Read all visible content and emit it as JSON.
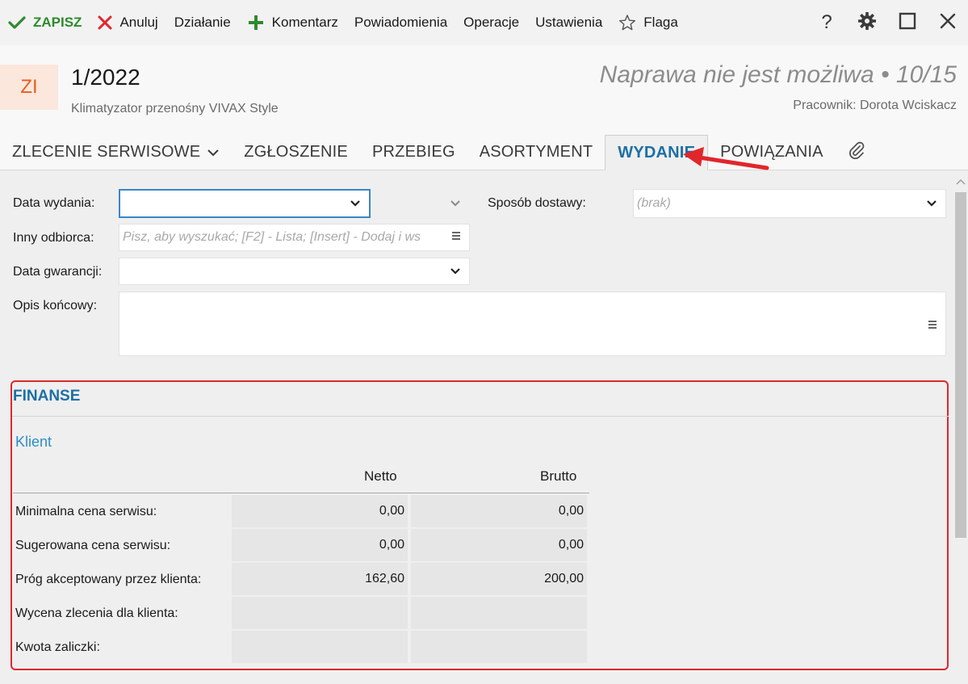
{
  "toolbar": {
    "save_label": "ZAPISZ",
    "cancel_label": "Anuluj",
    "action_label": "Działanie",
    "comment_label": "Komentarz",
    "notifications_label": "Powiadomienia",
    "operations_label": "Operacje",
    "settings_label": "Ustawienia",
    "flag_label": "Flaga",
    "help_label": "?"
  },
  "header": {
    "badge": "ZI",
    "number": "1/2022",
    "subtitle": "Klimatyzator przenośny VIVAX Style",
    "status": "Naprawa nie jest możliwa • 10/15",
    "worker": "Pracownik: Dorota Wciskacz"
  },
  "tabs": [
    {
      "label": "ZLECENIE SERWISOWE"
    },
    {
      "label": "ZGŁOSZENIE"
    },
    {
      "label": "PRZEBIEG"
    },
    {
      "label": "ASORTYMENT"
    },
    {
      "label": "WYDANIE"
    },
    {
      "label": "POWIĄZANIA"
    }
  ],
  "form": {
    "issue_date_label": "Data wydania:",
    "delivery_label": "Sposób dostawy:",
    "delivery_value": "(brak)",
    "other_recipient_label": "Inny odbiorca:",
    "other_recipient_placeholder": "Pisz, aby wyszukać; [F2] - Lista; [Insert] - Dodaj i ws",
    "warranty_label": "Data gwarancji:",
    "final_desc_label": "Opis końcowy:"
  },
  "finance": {
    "title": "FINANSE",
    "client_label": "Klient",
    "net_header": "Netto",
    "gross_header": "Brutto",
    "rows": [
      {
        "label": "Minimalna cena serwisu:",
        "net": "0,00",
        "gross": "0,00"
      },
      {
        "label": "Sugerowana cena serwisu:",
        "net": "0,00",
        "gross": "0,00"
      },
      {
        "label": "Próg akceptowany przez klienta:",
        "net": "162,60",
        "gross": "200,00"
      },
      {
        "label": "Wycena zlecenia dla klienta:",
        "net": "",
        "gross": ""
      },
      {
        "label": "Kwota zaliczki:",
        "net": "",
        "gross": ""
      }
    ]
  },
  "colors": {
    "accent": "#1d6fa5",
    "highlight_red": "#e1262c",
    "save_green": "#2e8a2e"
  },
  "icons": [
    "check-icon",
    "close-x-icon",
    "plus-icon",
    "star-icon",
    "gear-icon",
    "maximize-icon",
    "close-window-icon",
    "chevron-down-icon",
    "paperclip-icon",
    "menu-lines-icon",
    "red-arrow-annotation"
  ]
}
